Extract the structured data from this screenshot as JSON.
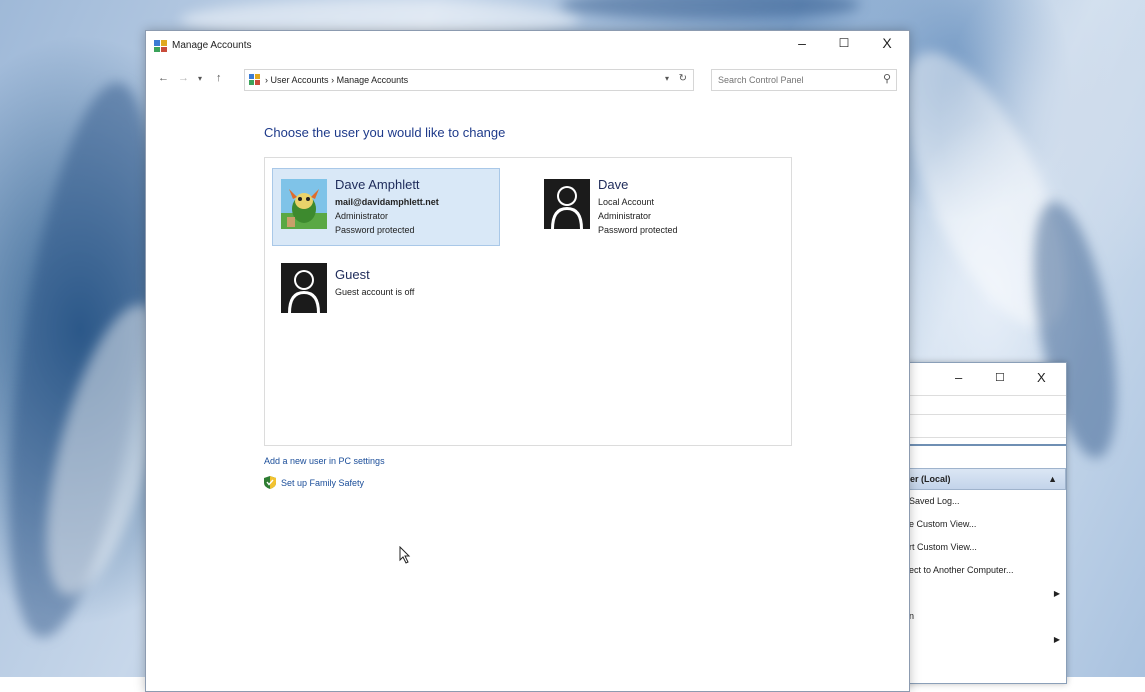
{
  "main_window": {
    "title": "Manage Accounts",
    "controls": {
      "minimize": "–",
      "maximize": "☐",
      "close": "X"
    },
    "breadcrumb": {
      "separator": "›",
      "items": [
        "User Accounts",
        "Manage Accounts"
      ]
    },
    "search": {
      "placeholder": "Search Control Panel"
    },
    "heading": "Choose the user you would like to change",
    "accounts": [
      {
        "name": "Dave Amphlett",
        "lines": [
          "mail@davidamphlett.net",
          "Administrator",
          "Password protected"
        ],
        "selected": true,
        "avatar_icon": "cartoon-avatar-icon"
      },
      {
        "name": "Dave",
        "lines": [
          "Local Account",
          "Administrator",
          "Password protected"
        ],
        "selected": false,
        "avatar_icon": "default-user-avatar-icon"
      },
      {
        "name": "Guest",
        "lines": [
          "Guest account is off"
        ],
        "selected": false,
        "avatar_icon": "default-user-avatar-icon"
      }
    ],
    "links": {
      "add_user": "Add a new user in PC settings",
      "family_safety": "Set up Family Safety"
    }
  },
  "back_window": {
    "controls": {
      "minimize": "–",
      "maximize": "☐",
      "close": "X"
    },
    "section_header": "er (Local)",
    "items": [
      {
        "label": "Saved Log...",
        "submenu": false
      },
      {
        "label": "e Custom View...",
        "submenu": false
      },
      {
        "label": "rt Custom View...",
        "submenu": false
      },
      {
        "label": "ect to Another Computer...",
        "submenu": false
      },
      {
        "label": "",
        "submenu": true
      },
      {
        "label": "n",
        "submenu": false
      },
      {
        "label": "",
        "submenu": true
      }
    ]
  },
  "colors": {
    "heading": "#1e3a8a",
    "link": "#1a4d99",
    "selection": "#d9e8f7"
  }
}
